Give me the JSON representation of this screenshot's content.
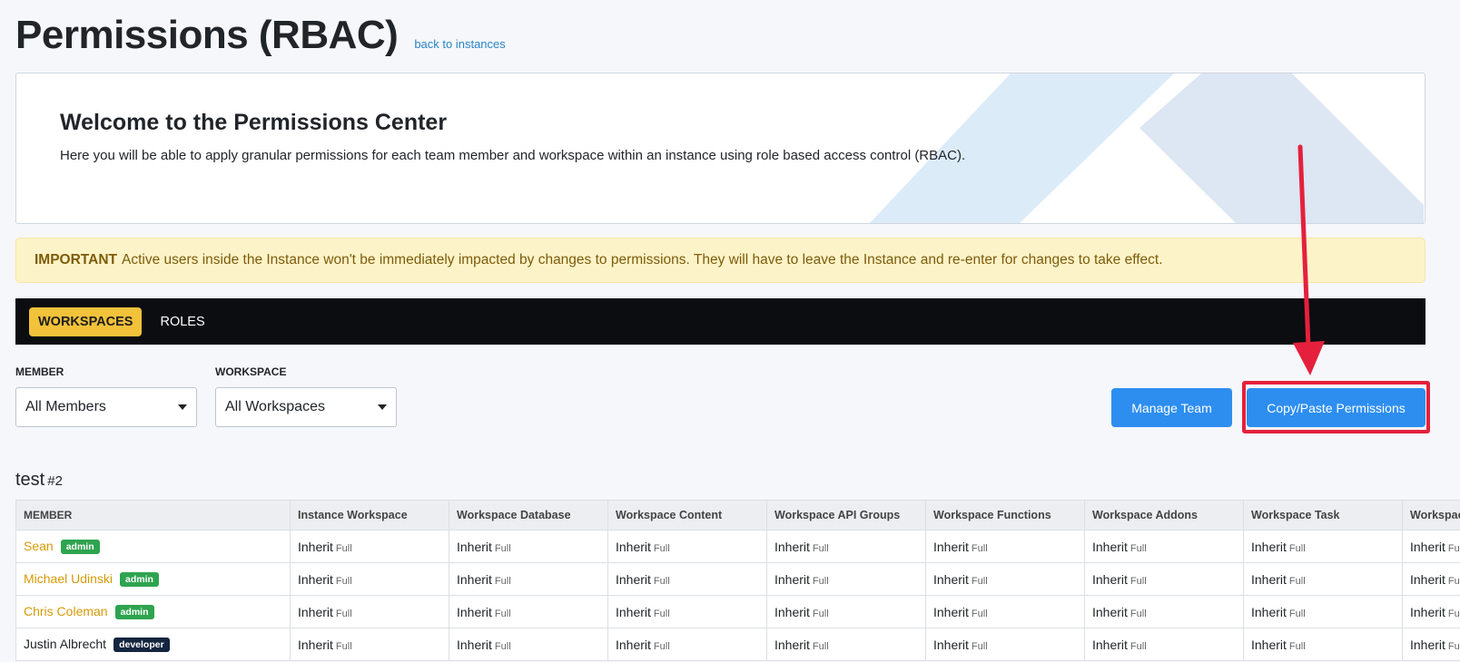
{
  "header": {
    "title": "Permissions (RBAC)",
    "back_link": "back to instances"
  },
  "welcome": {
    "title": "Welcome to the Permissions Center",
    "text": "Here you will be able to apply granular permissions for each team member and workspace within an instance using role based access control (RBAC)."
  },
  "alert": {
    "label": "IMPORTANT",
    "text": "Active users inside the Instance won't be immediately impacted by changes to permissions. They will have to leave the Instance and re-enter for changes to take effect."
  },
  "tabs": [
    {
      "label": "WORKSPACES",
      "active": true
    },
    {
      "label": "ROLES",
      "active": false
    }
  ],
  "filters": {
    "member": {
      "label": "MEMBER",
      "value": "All Members"
    },
    "workspace": {
      "label": "WORKSPACE",
      "value": "All Workspaces"
    }
  },
  "actions": {
    "manage_team": "Manage Team",
    "copy_paste": "Copy/Paste Permissions"
  },
  "section": {
    "name": "test",
    "number": "#2"
  },
  "table": {
    "columns": [
      "MEMBER",
      "Instance Workspace",
      "Workspace Database",
      "Workspace Content",
      "Workspace API Groups",
      "Workspace Functions",
      "Workspace Addons",
      "Workspace Task",
      "Workspace"
    ],
    "rows": [
      {
        "name": "Sean",
        "role": "admin"
      },
      {
        "name": "Michael Udinski",
        "role": "admin"
      },
      {
        "name": "Chris Coleman",
        "role": "admin"
      },
      {
        "name": "Justin Albrecht",
        "role": "developer"
      }
    ],
    "cell_value": "Inherit",
    "cell_level": "Full"
  },
  "colors": {
    "accent": "#f2c23a",
    "primary_button": "#2d8ef0",
    "annotation": "#e5203c",
    "admin_badge": "#2ea44f",
    "developer_badge": "#14253f"
  }
}
